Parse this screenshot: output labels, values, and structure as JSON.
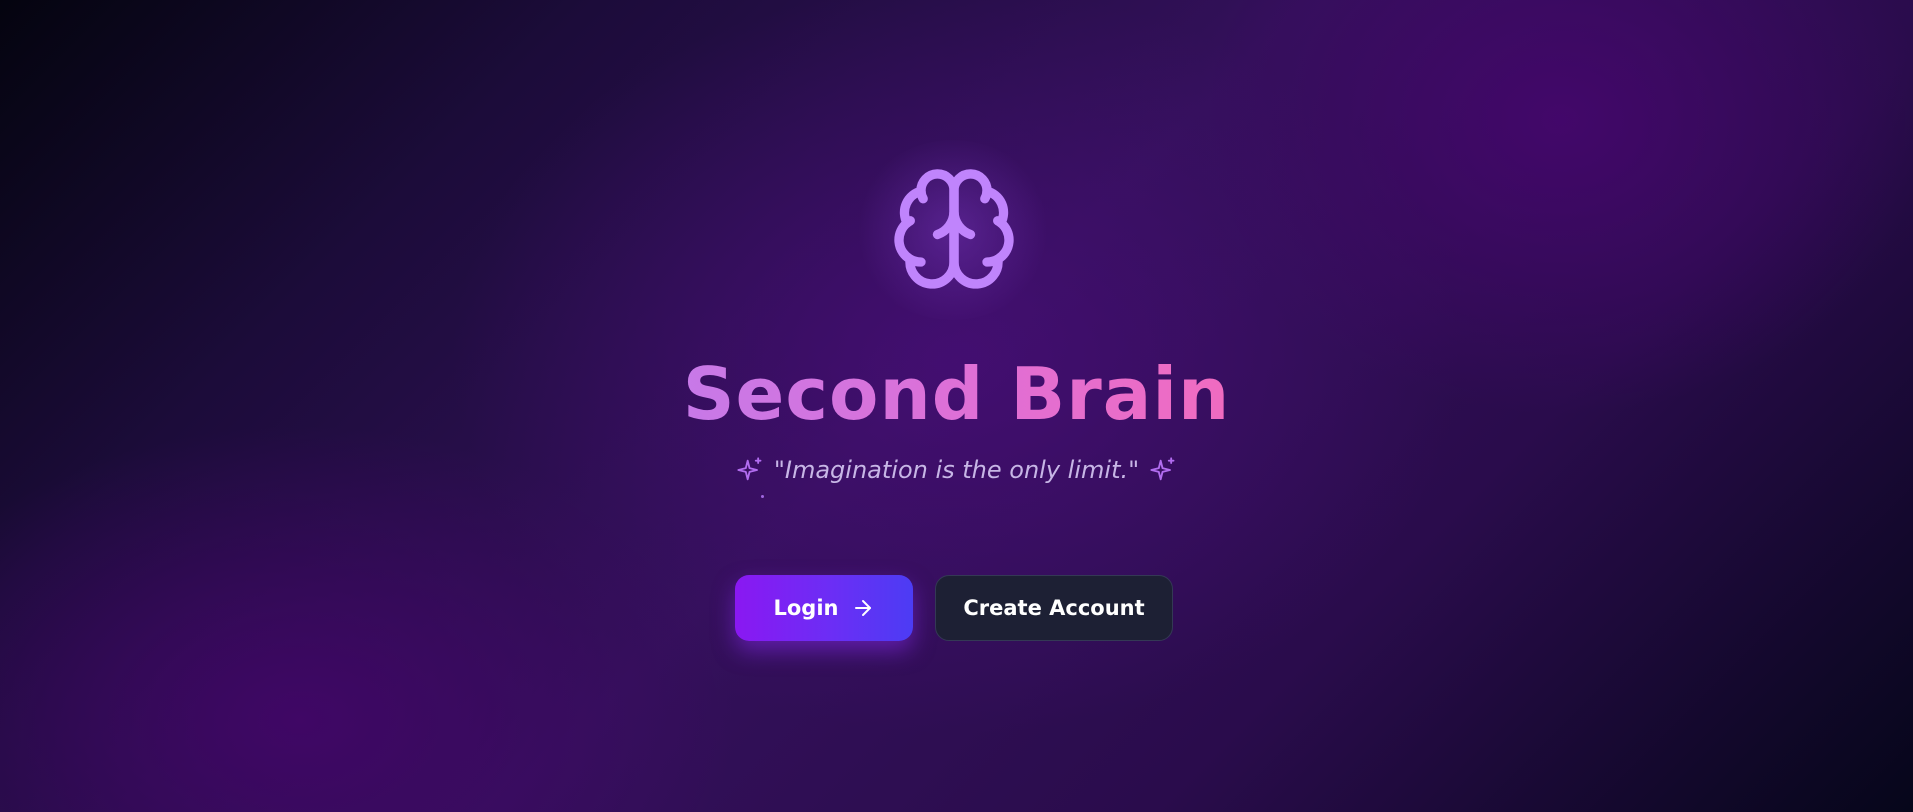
{
  "app": {
    "title": "Second Brain",
    "tagline": "\"Imagination is the only limit.\""
  },
  "icons": {
    "logo": "brain-icon",
    "tagline_left": "sparkle-icon",
    "tagline_right": "sparkle-icon",
    "login_arrow": "arrow-right-icon"
  },
  "actions": {
    "login_label": "Login",
    "create_account_label": "Create Account"
  },
  "colors": {
    "accent_purple": "#c084fc",
    "title_gradient_start": "#c779e8",
    "title_gradient_end": "#f06bc0",
    "login_gradient_start": "#8a18f2",
    "login_gradient_end": "#4c3cf4",
    "secondary_button": "#1d2034",
    "tagline_text": "#c7b6e6"
  }
}
